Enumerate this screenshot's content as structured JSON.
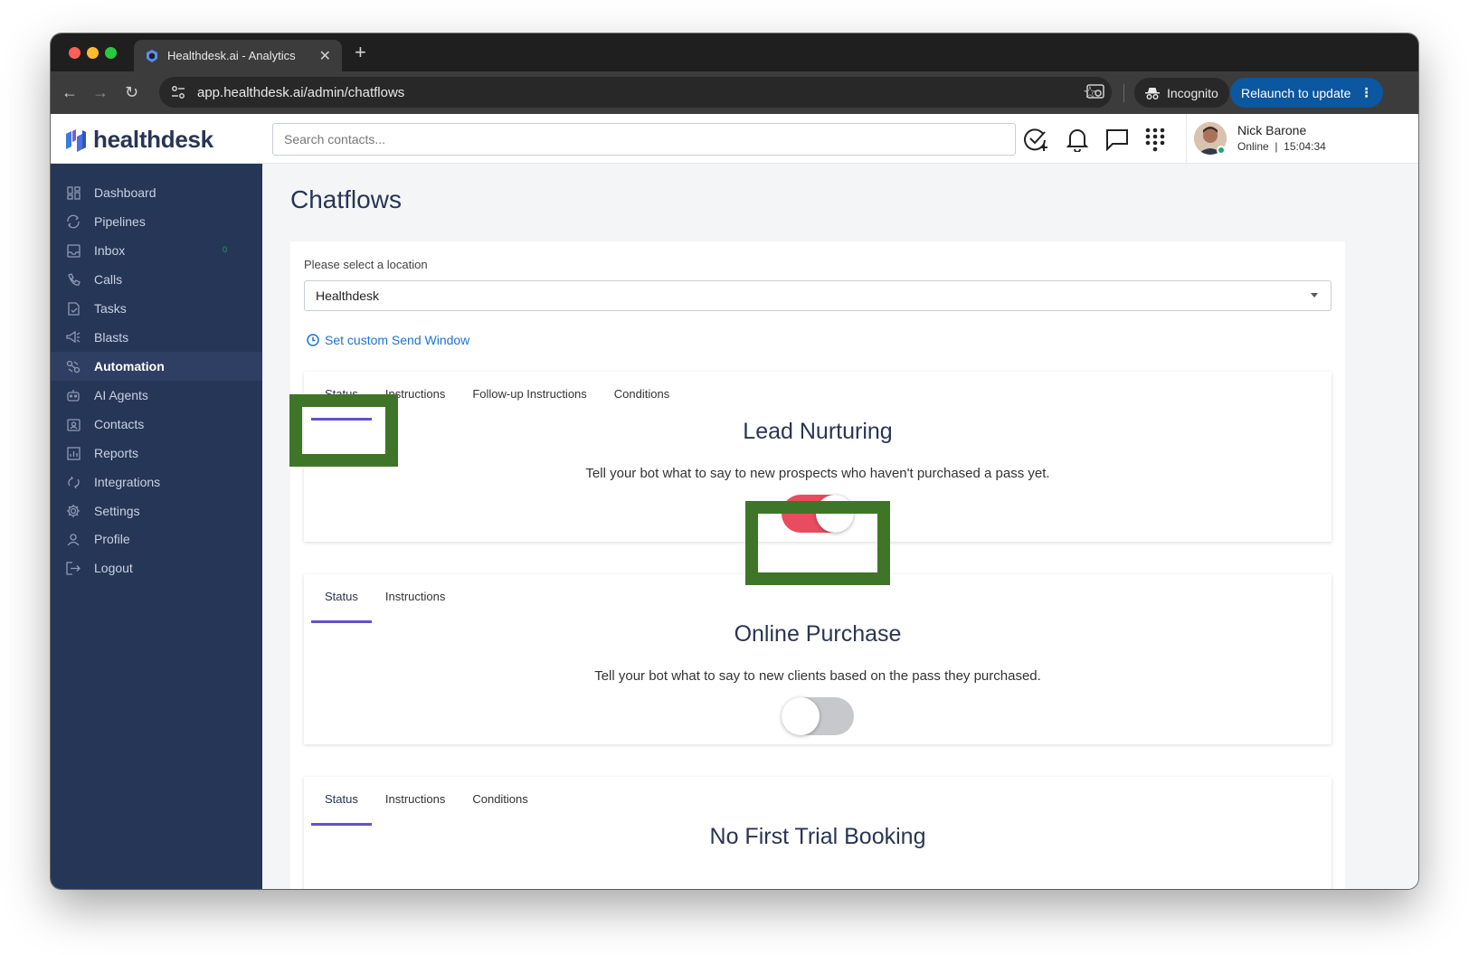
{
  "browser": {
    "tab_title": "Healthdesk.ai - Analytics",
    "url": "app.healthdesk.ai/admin/chatflows",
    "incognito_label": "Incognito",
    "relaunch_label": "Relaunch to update"
  },
  "header": {
    "logo_text": "healthdesk",
    "search_placeholder": "Search contacts...",
    "user_name": "Nick Barone",
    "user_status": "Online  |  15:04:34"
  },
  "sidebar": {
    "items": [
      {
        "label": "Dashboard",
        "icon": "dashboard-icon"
      },
      {
        "label": "Pipelines",
        "icon": "pipelines-icon"
      },
      {
        "label": "Inbox",
        "icon": "inbox-icon",
        "badge": "0"
      },
      {
        "label": "Calls",
        "icon": "phone-icon"
      },
      {
        "label": "Tasks",
        "icon": "tasks-icon"
      },
      {
        "label": "Blasts",
        "icon": "megaphone-icon"
      },
      {
        "label": "Automation",
        "icon": "automation-icon",
        "active": true
      },
      {
        "label": "AI Agents",
        "icon": "robot-icon"
      },
      {
        "label": "Contacts",
        "icon": "contacts-icon"
      },
      {
        "label": "Reports",
        "icon": "reports-icon"
      },
      {
        "label": "Integrations",
        "icon": "integrations-icon"
      },
      {
        "label": "Settings",
        "icon": "gear-icon"
      },
      {
        "label": "Profile",
        "icon": "user-icon"
      },
      {
        "label": "Logout",
        "icon": "logout-icon"
      }
    ]
  },
  "main": {
    "page_title": "Chatflows",
    "location_label": "Please select a location",
    "location_value": "Healthdesk",
    "send_window_link": "Set custom Send Window",
    "cards": [
      {
        "tabs": [
          "Status",
          "Instructions",
          "Follow-up Instructions",
          "Conditions"
        ],
        "title": "Lead Nurturing",
        "description": "Tell your bot what to say to new prospects who haven't purchased a pass yet.",
        "enabled": true
      },
      {
        "tabs": [
          "Status",
          "Instructions"
        ],
        "title": "Online Purchase",
        "description": "Tell your bot what to say to new clients based on the pass they purchased.",
        "enabled": false
      },
      {
        "tabs": [
          "Status",
          "Instructions",
          "Conditions"
        ],
        "title": "No First Trial Booking"
      }
    ]
  },
  "colors": {
    "sidebar_bg": "#263657",
    "accent_purple": "#6650c9",
    "toggle_on": "#e84c5e",
    "link_blue": "#1a73d9",
    "highlight_green": "#3f7528"
  }
}
